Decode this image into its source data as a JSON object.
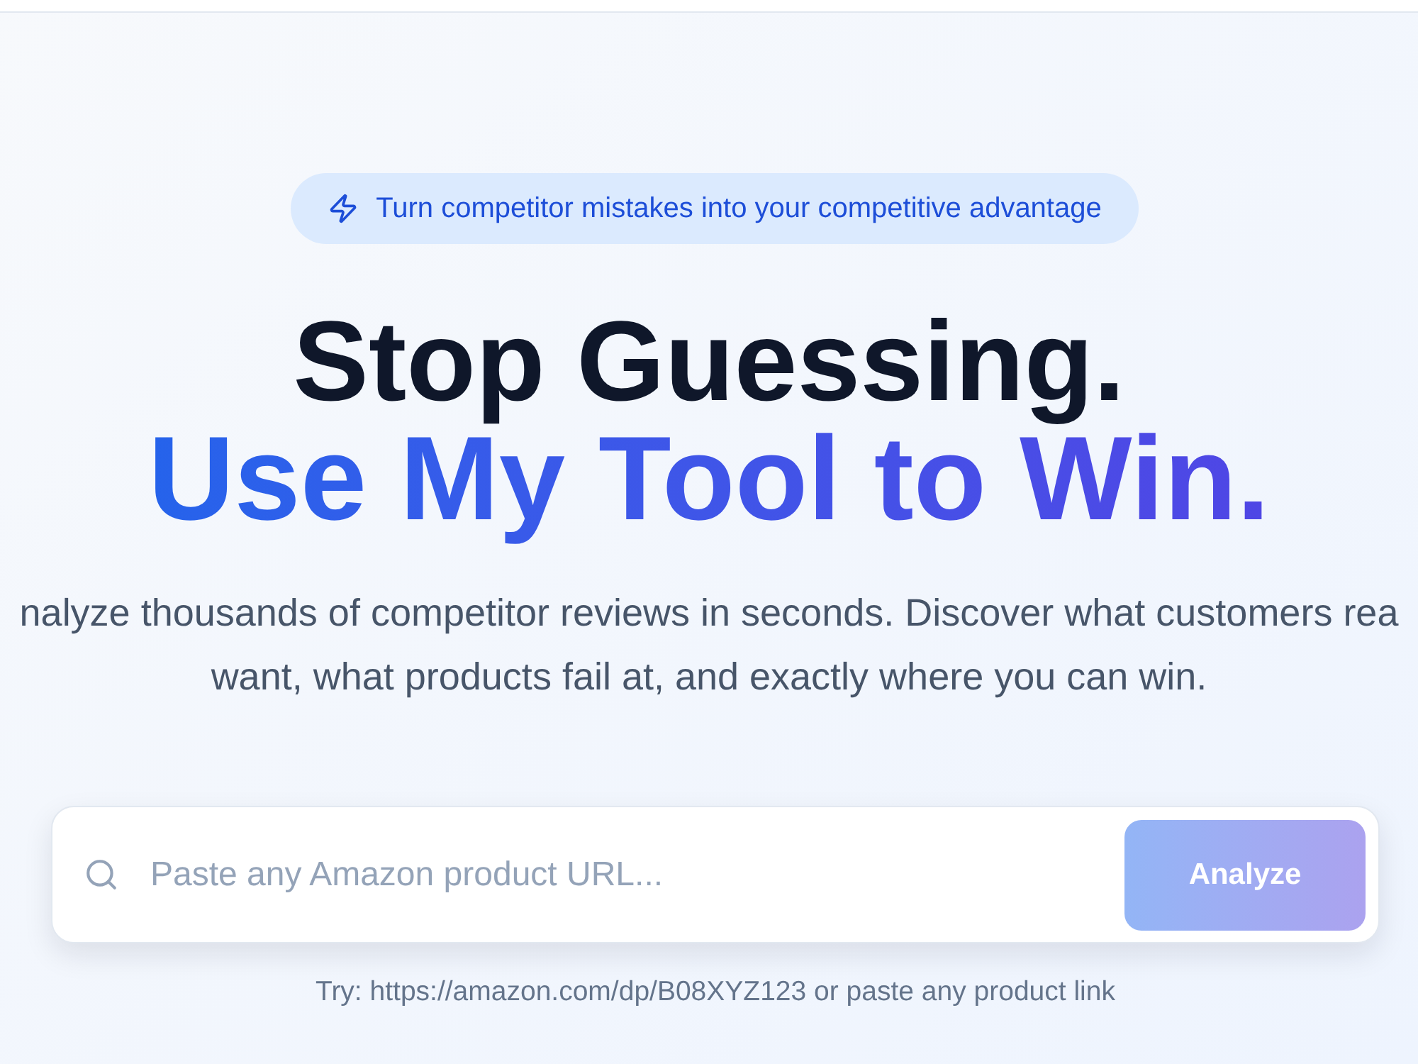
{
  "badge": {
    "text": "Turn competitor mistakes into your competitive advantage"
  },
  "headline": {
    "line_1": "Stop Guessing.",
    "line_2": "Use My Tool to Win."
  },
  "description": {
    "lines": [
      "nalyze thousands of competitor reviews in seconds. Discover what customers rea",
      "want, what products fail at, and exactly where you can win."
    ]
  },
  "search": {
    "placeholder": "Paste any Amazon product URL...",
    "button": {
      "label": "Analyze",
      "disabled": true
    }
  },
  "hint": "Try: https://amazon.com/dp/B08XYZ123 or paste any product link"
}
